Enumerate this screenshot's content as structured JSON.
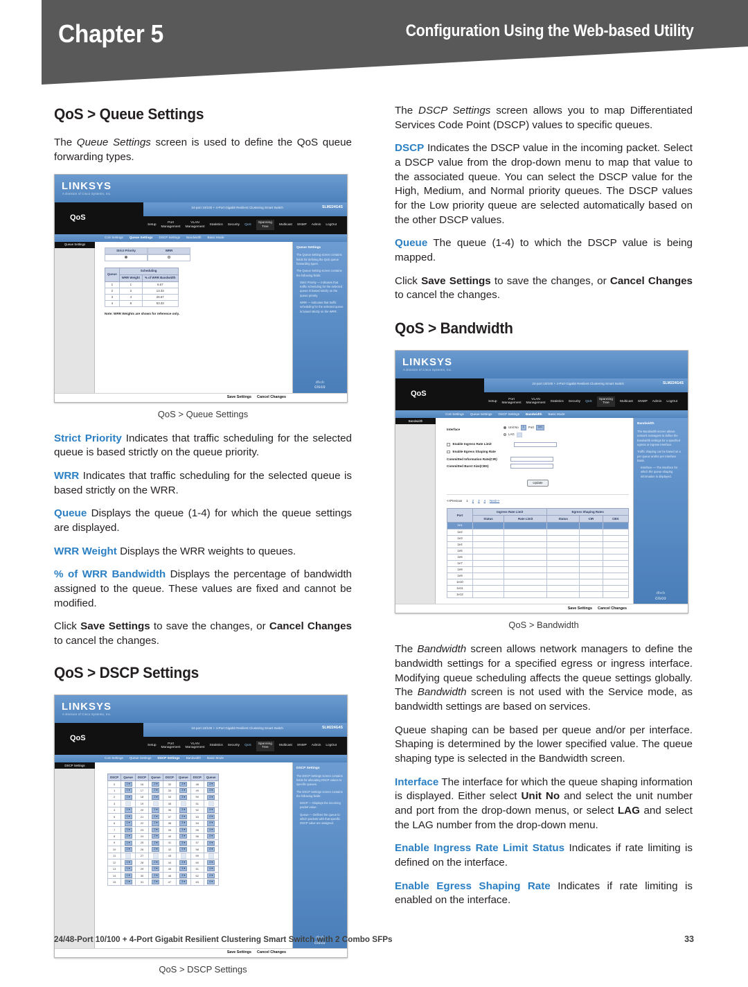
{
  "header": {
    "chapter": "Chapter 5",
    "subtitle": "Configuration Using the Web-based Utility"
  },
  "footer": {
    "product": "24/48-Port 10/100 + 4-Port Gigabit Resilient Clustering Smart Switch with 2 Combo SFPs",
    "page": "33"
  },
  "left_column": {
    "heading_queue": "QoS > Queue Settings",
    "intro_queue_pre": "The ",
    "intro_queue_ital": "Queue Settings",
    "intro_queue_post": " screen is used to define the QoS queue forwarding types.",
    "caption_queue": "QoS > Queue Settings",
    "p_strict_term": "Strict Priority",
    "p_strict_text": " Indicates that traffic scheduling for the selected queue is based strictly on the queue priority.",
    "p_wrr_term": "WRR",
    "p_wrr_text": " Indicates that traffic scheduling for the selected queue is based strictly on the WRR.",
    "p_queue_term": "Queue",
    "p_queue_text": " Displays the queue (1-4) for which the queue settings are displayed.",
    "p_wrrweight_term": "WRR Weight",
    "p_wrrweight_text": "  Displays the WRR weights to queues.",
    "p_pct_term": "% of WRR Bandwidth",
    "p_pct_text": " Displays the percentage of bandwidth assigned to the queue. These values are fixed and cannot be modified.",
    "p_click_1": "Click ",
    "p_click_save": "Save Settings",
    "p_click_2": " to save the changes, or ",
    "p_click_cancel": "Cancel Changes",
    "p_click_3": " to cancel the changes.",
    "heading_dscp": "QoS > DSCP Settings",
    "caption_dscp": "QoS > DSCP Settings"
  },
  "right_column": {
    "intro_dscp_pre": "The ",
    "intro_dscp_ital": "DSCP Settings",
    "intro_dscp_post": " screen allows you to map Differentiated Services Code Point (DSCP) values to specific queues.",
    "p_dscp_term": "DSCP",
    "p_dscp_text": "  Indicates the DSCP value in the incoming packet. Select a DSCP value from the drop-down menu to map that value to the associated queue. You can select the DSCP value for the High, Medium, and Normal priority queues. The DSCP values for the Low priority queue are selected automatically based on the other DSCP values.",
    "p_queue_term": "Queue",
    "p_queue_text": "  The queue (1-4) to which the DSCP value is being mapped.",
    "p_click_1": "Click ",
    "p_click_save": "Save Settings",
    "p_click_2": " to save the changes, or ",
    "p_click_cancel": "Cancel Changes",
    "p_click_3": " to cancel the changes.",
    "heading_bandwidth": "QoS > Bandwidth",
    "caption_bandwidth": "QoS > Bandwidth",
    "p_bw_pre": "The ",
    "p_bw_ital1": "Bandwidth",
    "p_bw_mid": " screen allows network managers to define the bandwidth settings for a specified egress or ingress interface. Modifying queue scheduling affects the queue settings globally. The ",
    "p_bw_ital2": "Bandwidth",
    "p_bw_post": " screen is not used with the Service mode, as bandwidth settings are based on services.",
    "p_shaping": "Queue shaping can be based per queue and/or per interface. Shaping is determined by the lower specified value. The queue shaping type is selected in the Bandwidth screen.",
    "p_iface_term": "Interface",
    "p_iface_1": " The interface for which the queue shaping information is displayed. Either select ",
    "p_iface_unitno": "Unit No",
    "p_iface_2": " and select the unit number and port from the drop-down menus, or select ",
    "p_iface_lag": "LAG",
    "p_iface_3": " and select the LAG number from the drop-down menu.",
    "p_ingress_term": "Enable Ingress Rate Limit Status",
    "p_ingress_text": "  Indicates if rate limiting is defined on the interface.",
    "p_egress_term": "Enable Egress Shaping Rate",
    "p_egress_text": " Indicates if rate limiting is enabled on the interface."
  },
  "screenshot_common": {
    "brand": "LINKSYS",
    "brand_sub": "A Division of Cisco Systems, Inc.",
    "model_text": "24-port 10/100 + 4-Port Gigabit Resilient Clustering Smart Switch",
    "model_code": "SLM224G4S",
    "nav_title": "QoS",
    "nav_items": [
      "Setup",
      "Port\nManagement",
      "VLAN\nManagement",
      "Statistics",
      "Security",
      "QoS",
      "Spanning\nTree",
      "Multicast",
      "SNMP",
      "Admin",
      "LogOut"
    ],
    "subnav_items": [
      "CoS Settings",
      "Queue Settings",
      "DSCP Settings",
      "Bandwidth",
      "Basic Mode"
    ],
    "save_label": "Save Settings",
    "cancel_label": "Cancel Changes",
    "cisco_wordmark": "cisco",
    "cisco_bars": "ıllıılı"
  },
  "screenshot_queue": {
    "left_tab": "Queue Settings",
    "mode_headers": [
      "Strict Priority",
      "WRR"
    ],
    "table_top_header": "Scheduling",
    "table_headers": [
      "Queue",
      "WRR Weight",
      "% of WRR Bandwidth"
    ],
    "rows": [
      {
        "queue": "1",
        "weight": "1",
        "pct": "6.67"
      },
      {
        "queue": "2",
        "weight": "2",
        "pct": "13.33"
      },
      {
        "queue": "3",
        "weight": "4",
        "pct": "26.67"
      },
      {
        "queue": "4",
        "weight": "8",
        "pct": "53.33"
      }
    ],
    "note": "Note: WRR Weights are shown for reference only.",
    "help_title": "Queue Settings",
    "help_p1": "The Queue Setting screen contains fields for defining the QoS queue forwarding types.",
    "help_p2": "The Queue Setting screen contains the following fields:",
    "help_li1": "Strict Priority — Indicates that traffic scheduling for the selected queue is based strictly on the queue priority.",
    "help_li2": "WRR — Indicates that traffic scheduling for the selected queue is based strictly on the WRR."
  },
  "screenshot_dscp": {
    "left_tab": "DSCP Settings",
    "headers": [
      "DSCP",
      "Queue",
      "DSCP",
      "Queue",
      "DSCP",
      "Queue",
      "DSCP",
      "Queue"
    ],
    "rows": [
      [
        "0",
        "1",
        "16",
        "2",
        "32",
        "3",
        "48",
        "4"
      ],
      [
        "1",
        "1",
        "17",
        "2",
        "33",
        "3",
        "49",
        "4"
      ],
      [
        "2",
        "1",
        "18",
        "2",
        "34",
        "3",
        "50",
        "4"
      ],
      [
        "3",
        "",
        "19",
        "",
        "35",
        "",
        "51",
        ""
      ],
      [
        "4",
        "1",
        "20",
        "2",
        "36",
        "3",
        "52",
        "4"
      ],
      [
        "5",
        "1",
        "21",
        "2",
        "37",
        "3",
        "53",
        "4"
      ],
      [
        "6",
        "1",
        "22",
        "2",
        "38",
        "3",
        "54",
        "4"
      ],
      [
        "7",
        "1",
        "23",
        "2",
        "39",
        "3",
        "55",
        "4"
      ],
      [
        "8",
        "1",
        "24",
        "2",
        "40",
        "3",
        "56",
        "4"
      ],
      [
        "9",
        "1",
        "25",
        "2",
        "41",
        "3",
        "57",
        "4"
      ],
      [
        "10",
        "1",
        "26",
        "2",
        "42",
        "3",
        "58",
        "4"
      ],
      [
        "11",
        "",
        "27",
        "",
        "43",
        "",
        "59",
        ""
      ],
      [
        "12",
        "1",
        "28",
        "2",
        "44",
        "3",
        "60",
        "4"
      ],
      [
        "13",
        "1",
        "29",
        "2",
        "45",
        "3",
        "61",
        "4"
      ],
      [
        "14",
        "1",
        "30",
        "2",
        "46",
        "3",
        "62",
        "4"
      ],
      [
        "15",
        "1",
        "31",
        "2",
        "47",
        "3",
        "63",
        "4"
      ]
    ],
    "help_title": "DSCP Settings",
    "help_p1": "The DSCP Settings screen contains fields for allocating DSCP values to specific queues.",
    "help_p2": "The DSCP Settings screen contains the following fields:",
    "help_li1": "DSCP — Displays the incoming packet value.",
    "help_li2": "Queue — Defines the queue to which packets with that specific DSCP value are assigned."
  },
  "screenshot_bandwidth": {
    "left_tab": "Bandwidth",
    "interface_label": "Interface",
    "unit_no_label": "Unit No",
    "unit_value": "1",
    "port_label": "Port",
    "port_value": "1e1",
    "lag_label": "LAG",
    "chk_ingress": "Enable Ingress Rate Limit",
    "chk_egress": "Enable Egress Shaping Rate",
    "cir_label": "Committed Information Rate(CIR)",
    "cbs_label": "Committed Burst Size(CBS)",
    "update_label": "Update",
    "pager": [
      "<<Previous",
      "1",
      "2",
      "3",
      "4",
      "Next>>"
    ],
    "table_group_headers": [
      "Port",
      "Ingress Rate Limit",
      "Egress Shaping Rates"
    ],
    "table_sub_headers": [
      "Status",
      "Rate Limit",
      "Status",
      "CIR",
      "CBS"
    ],
    "rows": [
      "1e1",
      "1e2",
      "1e3",
      "1e4",
      "1e5",
      "1e6",
      "1e7",
      "1e8",
      "1e9",
      "1e10",
      "1e11",
      "1e12"
    ],
    "help_title": "Bandwidth",
    "help_p1": "The Bandwidth screen allows network managers to define the bandwidth settings for a specified egress or ingress interface.",
    "help_p2": "Traffic shaping can be based on a per queue and/or per interface basis.",
    "help_li1": "Interface — The interface for which the queue shaping information is displayed."
  }
}
